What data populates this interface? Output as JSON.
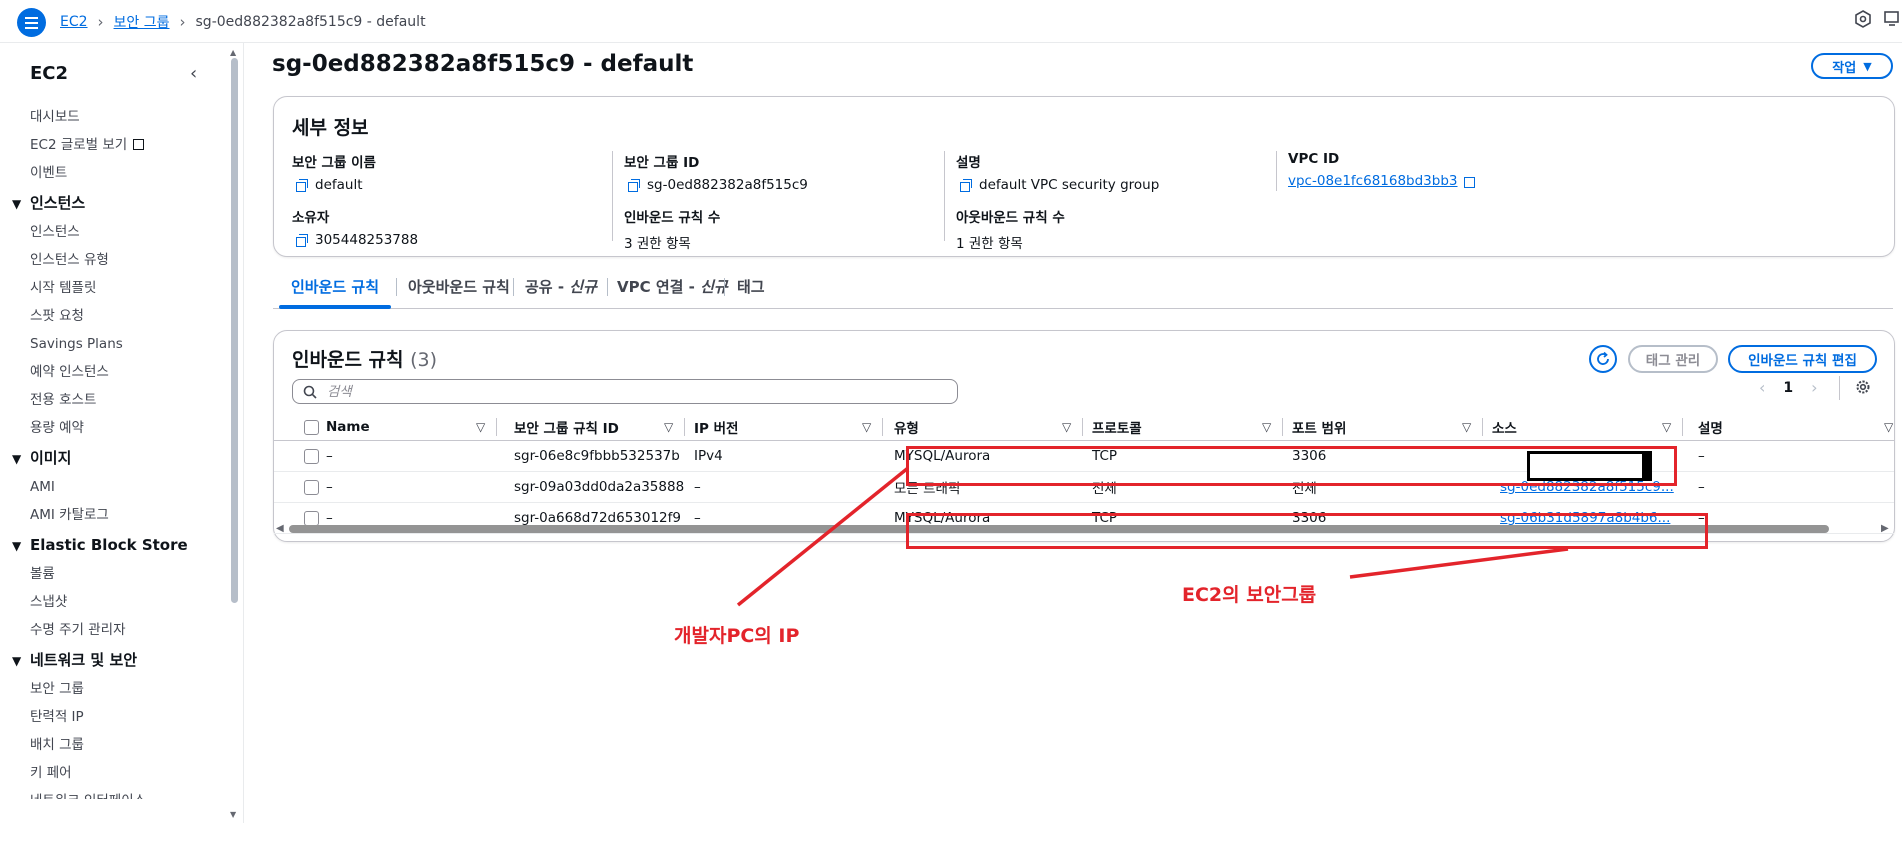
{
  "breadcrumb": {
    "root": "EC2",
    "section": "보안 그룹",
    "current": "sg-0ed882382a8f515c9 - default"
  },
  "sidebar": {
    "title": "EC2",
    "top_items": [
      {
        "label": "대시보드"
      },
      {
        "label": "EC2 글로벌 보기"
      },
      {
        "label": "이벤트"
      }
    ],
    "groups": [
      {
        "label": "인스턴스",
        "items": [
          "인스턴스",
          "인스턴스 유형",
          "시작 템플릿",
          "스팟 요청",
          "Savings Plans",
          "예약 인스턴스",
          "전용 호스트",
          "용량 예약"
        ]
      },
      {
        "label": "이미지",
        "items": [
          "AMI",
          "AMI 카탈로그"
        ]
      },
      {
        "label": "Elastic Block Store",
        "items": [
          "볼륨",
          "스냅샷",
          "수명 주기 관리자"
        ]
      },
      {
        "label": "네트워크 및 보안",
        "items": [
          "보안 그룹",
          "탄력적 IP",
          "배치 그룹",
          "키 페어",
          "네트워크 인터페이스"
        ]
      }
    ]
  },
  "page": {
    "title": "sg-0ed882382a8f515c9 - default",
    "action_button": "작업"
  },
  "details": {
    "heading": "세부 정보",
    "fields": [
      {
        "label": "보안 그룹 이름",
        "value": "default",
        "copy": true
      },
      {
        "label": "보안 그룹 ID",
        "value": "sg-0ed882382a8f515c9",
        "copy": true
      },
      {
        "label": "설명",
        "value": "default VPC security group",
        "copy": true
      },
      {
        "label": "VPC ID",
        "value": "vpc-08e1fc68168bd3bb3",
        "link": true
      },
      {
        "label": "소유자",
        "value": "305448253788",
        "copy": true
      },
      {
        "label": "인바운드 규칙 수",
        "value": "3 권한 항목"
      },
      {
        "label": "아웃바운드 규칙 수",
        "value": "1 권한 항목"
      }
    ]
  },
  "tabs": [
    {
      "label": "인바운드 규칙",
      "suffix": ""
    },
    {
      "label": "아웃바운드 규칙",
      "suffix": ""
    },
    {
      "label": "공유 - ",
      "suffix": "신규"
    },
    {
      "label": "VPC 연결 - ",
      "suffix": "신규"
    },
    {
      "label": "태그",
      "suffix": ""
    }
  ],
  "rules": {
    "heading": "인바운드 규칙",
    "count": "(3)",
    "search_placeholder": "검색",
    "manage_tags": "태그 관리",
    "edit_rules": "인바운드 규칙 편집",
    "page": "1",
    "columns": [
      "Name",
      "보안 그룹 규칙 ID",
      "IP 버전",
      "유형",
      "프로토콜",
      "포트 범위",
      "소스",
      "설명"
    ],
    "rows": [
      {
        "name": "–",
        "id": "sgr-06e8c9fbbb532537b",
        "ip": "IPv4",
        "type": "MYSQL/Aurora",
        "protocol": "TCP",
        "port": "3306",
        "source": "",
        "desc": "–"
      },
      {
        "name": "–",
        "id": "sgr-09a03dd0da2a35888",
        "ip": "–",
        "type": "모든 트래픽",
        "protocol": "전체",
        "port": "전체",
        "source": "sg-0ed882382a8f515c9...",
        "desc": "–"
      },
      {
        "name": "–",
        "id": "sgr-0a668d72d653012f9",
        "ip": "–",
        "type": "MYSQL/Aurora",
        "protocol": "TCP",
        "port": "3306",
        "source": "sg-06b31d5897a8b4b6...",
        "desc": "–"
      }
    ]
  },
  "annotations": {
    "dev_ip": "개발자PC의 IP",
    "ec2_sg": "EC2의 보안그룹",
    "color": "#e3242b"
  },
  "colors": {
    "accent": "#006ce0",
    "text": "#0f141a",
    "border": "#c6c6cd"
  }
}
